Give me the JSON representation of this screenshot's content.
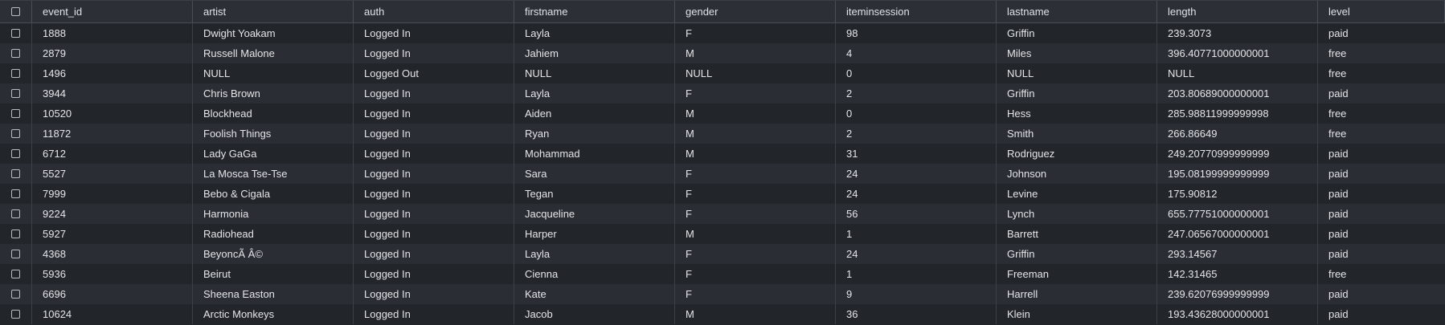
{
  "table": {
    "columns": [
      {
        "key": "event_id",
        "label": "event_id"
      },
      {
        "key": "artist",
        "label": "artist"
      },
      {
        "key": "auth",
        "label": "auth"
      },
      {
        "key": "firstname",
        "label": "firstname"
      },
      {
        "key": "gender",
        "label": "gender"
      },
      {
        "key": "iteminsession",
        "label": "iteminsession"
      },
      {
        "key": "lastname",
        "label": "lastname"
      },
      {
        "key": "length",
        "label": "length"
      },
      {
        "key": "level",
        "label": "level"
      }
    ],
    "rows": [
      [
        "1888",
        "Dwight Yoakam",
        "Logged In",
        "Layla",
        "F",
        "98",
        "Griffin",
        "239.3073",
        "paid"
      ],
      [
        "2879",
        "Russell Malone",
        "Logged In",
        "Jahiem",
        "M",
        "4",
        "Miles",
        "396.40771000000001",
        "free"
      ],
      [
        "1496",
        "NULL",
        "Logged Out",
        "NULL",
        "NULL",
        "0",
        "NULL",
        "NULL",
        "free"
      ],
      [
        "3944",
        "Chris Brown",
        "Logged In",
        "Layla",
        "F",
        "2",
        "Griffin",
        "203.80689000000001",
        "paid"
      ],
      [
        "10520",
        "Blockhead",
        "Logged In",
        "Aiden",
        "M",
        "0",
        "Hess",
        "285.98811999999998",
        "free"
      ],
      [
        "11872",
        "Foolish Things",
        "Logged In",
        "Ryan",
        "M",
        "2",
        "Smith",
        "266.86649",
        "free"
      ],
      [
        "6712",
        "Lady GaGa",
        "Logged In",
        "Mohammad",
        "M",
        "31",
        "Rodriguez",
        "249.20770999999999",
        "paid"
      ],
      [
        "5527",
        "La Mosca Tse-Tse",
        "Logged In",
        "Sara",
        "F",
        "24",
        "Johnson",
        "195.08199999999999",
        "paid"
      ],
      [
        "7999",
        "Bebo & Cigala",
        "Logged In",
        "Tegan",
        "F",
        "24",
        "Levine",
        "175.90812",
        "paid"
      ],
      [
        "9224",
        "Harmonia",
        "Logged In",
        "Jacqueline",
        "F",
        "56",
        "Lynch",
        "655.77751000000001",
        "paid"
      ],
      [
        "5927",
        "Radiohead",
        "Logged In",
        "Harper",
        "M",
        "1",
        "Barrett",
        "247.06567000000001",
        "paid"
      ],
      [
        "4368",
        "BeyoncÃ   Â©",
        "Logged In",
        "Layla",
        "F",
        "24",
        "Griffin",
        "293.14567",
        "paid"
      ],
      [
        "5936",
        "Beirut",
        "Logged In",
        "Cienna",
        "F",
        "1",
        "Freeman",
        "142.31465",
        "free"
      ],
      [
        "6696",
        "Sheena Easton",
        "Logged In",
        "Kate",
        "F",
        "9",
        "Harrell",
        "239.62076999999999",
        "paid"
      ],
      [
        "10624",
        "Arctic Monkeys",
        "Logged In",
        "Jacob",
        "M",
        "36",
        "Klein",
        "193.43628000000001",
        "paid"
      ]
    ]
  }
}
